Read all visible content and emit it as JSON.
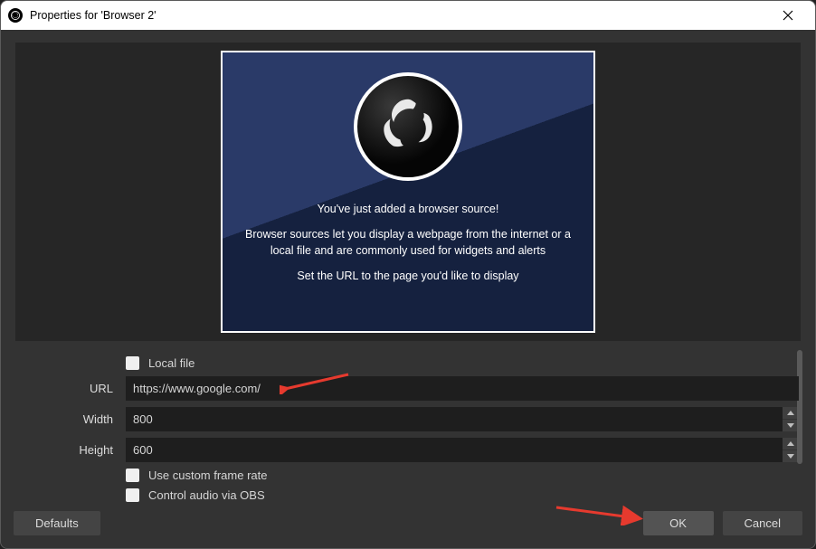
{
  "titlebar": {
    "title": "Properties for 'Browser 2'"
  },
  "preview": {
    "line1": "You've just added a browser source!",
    "line2": "Browser sources let you display a webpage from the internet or a local file and are commonly used for widgets and alerts",
    "line3": "Set the URL to the page you'd like to display"
  },
  "form": {
    "local_file_label": "Local file",
    "url_label": "URL",
    "url_value": "https://www.google.com/",
    "width_label": "Width",
    "width_value": "800",
    "height_label": "Height",
    "height_value": "600",
    "custom_frame_rate_label": "Use custom frame rate",
    "control_audio_label": "Control audio via OBS"
  },
  "footer": {
    "defaults_label": "Defaults",
    "ok_label": "OK",
    "cancel_label": "Cancel"
  }
}
